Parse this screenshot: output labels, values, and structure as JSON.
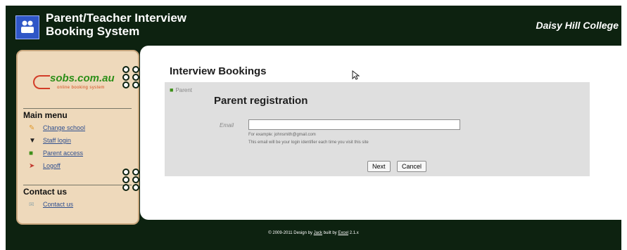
{
  "header": {
    "title_line1": "Parent/Teacher Interview",
    "title_line2": "Booking System",
    "college": "Daisy Hill College",
    "logo_icon": "people-icon"
  },
  "sidebar": {
    "brand": "sobs.com.au",
    "brand_tagline": "online booking system",
    "main_menu_heading": "Main menu",
    "items": [
      {
        "label": "Change school",
        "icon": "pencil-icon",
        "color": "#e09a2f"
      },
      {
        "label": "Staff login",
        "icon": "staff-icon",
        "color": "#222222"
      },
      {
        "label": "Parent access",
        "icon": "parent-icon",
        "color": "#3f8f19"
      },
      {
        "label": "Logoff",
        "icon": "logoff-icon",
        "color": "#c23a2f"
      }
    ],
    "contact_heading": "Contact us",
    "contact_item": {
      "label": "Contact us",
      "icon": "envelope-icon"
    }
  },
  "main": {
    "page_title": "Interview Bookings",
    "role_label": "Parent",
    "panel_title": "Parent registration",
    "email_label": "Email",
    "email_value": "",
    "hint_example": "For example: johnsmith@gmail.com",
    "hint_identifier": "This email will be your login identifier each time you visit this site",
    "next_label": "Next",
    "cancel_label": "Cancel"
  },
  "footer": {
    "copyright": "© 2009-2011 Design by",
    "design_link": "Jack",
    "built_by": "built by",
    "build_link": "Excel",
    "version": "2.1.x"
  }
}
